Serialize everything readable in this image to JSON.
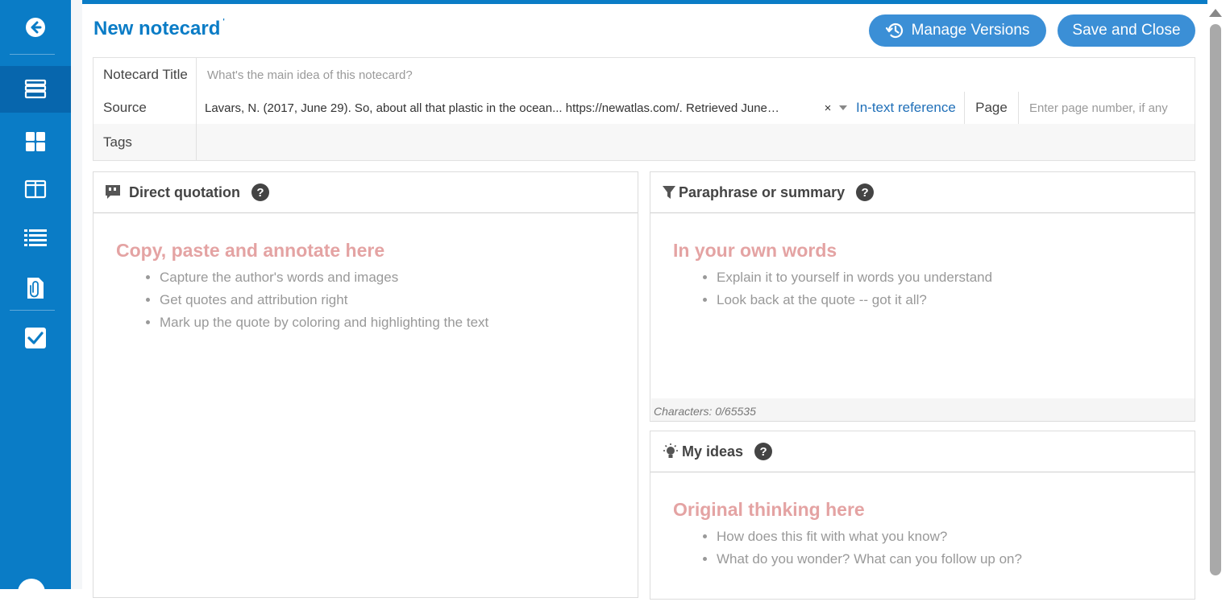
{
  "sidebar": {
    "items": [
      {
        "icon": "back-arrow-icon"
      },
      {
        "icon": "notecards-stack-icon",
        "active": true
      },
      {
        "icon": "dashboard-grid-icon"
      },
      {
        "icon": "split-view-icon"
      },
      {
        "icon": "outline-list-icon"
      },
      {
        "icon": "attachment-doc-icon"
      },
      {
        "icon": "checkbox-tasks-icon"
      }
    ]
  },
  "header": {
    "title": "New notecard",
    "title_mark": "'",
    "manage_versions_label": "Manage Versions",
    "save_close_label": "Save and Close"
  },
  "fields": {
    "title_label": "Notecard Title",
    "title_placeholder": "What's the main idea of this notecard?",
    "source_label": "Source",
    "source_value": "Lavars, N. (2017, June 29). So, about all that plastic in the ocean... https://newatlas.com/. Retrieved June…",
    "source_clear": "×",
    "in_text_reference": "In-text reference",
    "page_label": "Page",
    "page_placeholder": "Enter page number, if any",
    "tags_label": "Tags"
  },
  "panels": {
    "direct": {
      "title": "Direct quotation",
      "help": "?",
      "heading": "Copy, paste and annotate here",
      "bullets": [
        "Capture the author's words and images",
        "Get quotes and attribution right",
        "Mark up the quote by coloring and highlighting the text"
      ]
    },
    "paraphrase": {
      "title": "Paraphrase or summary",
      "help": "?",
      "heading": "In your own words",
      "bullets": [
        "Explain it to yourself in words you understand",
        "Look back at the quote -- got it all?"
      ],
      "char_count": "Characters: 0/65535"
    },
    "ideas": {
      "title": "My ideas",
      "help": "?",
      "heading": "Original thinking here",
      "bullets": [
        "How does this fit with what you know?",
        "What do you wonder? What can you follow up on?"
      ]
    }
  },
  "colors": {
    "brand": "#0a7cc6",
    "button": "#3b8fd6",
    "placeholder_heading": "#e4a3a3"
  }
}
